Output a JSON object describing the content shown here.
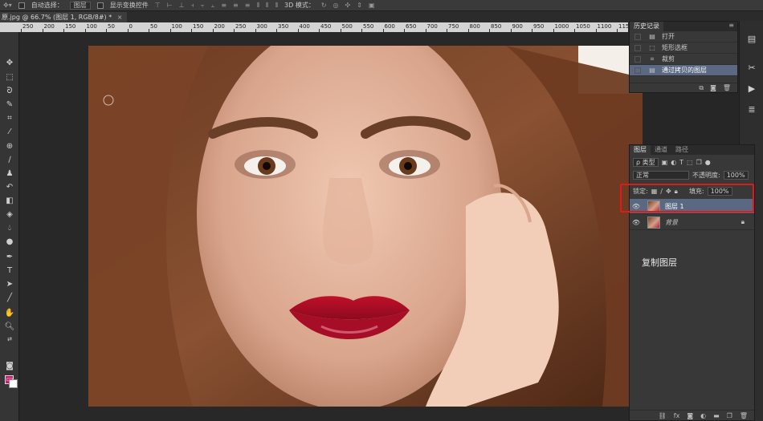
{
  "options_bar": {
    "move_icon": "move-tool-icon",
    "auto_select_label": "自动选择：",
    "auto_select_value": "图层",
    "show_transform_label": "显示变换控件",
    "mode_3d_label": "3D 模式："
  },
  "document": {
    "tab_title": "原.jpg @ 66.7% (图层 1, RGB/8#) *",
    "close_glyph": "×"
  },
  "ruler": {
    "ticks": [
      "250",
      "200",
      "150",
      "100",
      "50",
      "0",
      "50",
      "100",
      "150",
      "200",
      "250",
      "300",
      "350",
      "400",
      "450",
      "500",
      "550",
      "600",
      "650",
      "700",
      "750",
      "800",
      "850",
      "900",
      "950",
      "1000",
      "1050",
      "1100",
      "1150"
    ]
  },
  "history_panel": {
    "title": "历史记录",
    "snapshot_label": "原.jpg",
    "items": [
      {
        "icon": "document-icon",
        "label": "打开"
      },
      {
        "icon": "rect-marquee-icon",
        "label": "矩形选框"
      },
      {
        "icon": "crop-icon",
        "label": "裁剪"
      },
      {
        "icon": "document-icon",
        "label": "通过拷贝的图层",
        "active": true
      }
    ]
  },
  "layers_panel": {
    "tabs": [
      "图层",
      "通道",
      "路径"
    ],
    "active_tab": "图层",
    "filter_kind": "ρ 类型",
    "blend_mode": "正常",
    "opacity_label": "不透明度:",
    "opacity_value": "100%",
    "lock_label": "锁定:",
    "fill_label": "填充:",
    "fill_value": "100%",
    "layers": [
      {
        "name": "图层 1",
        "selected": true,
        "locked": false
      },
      {
        "name": "背景",
        "selected": false,
        "locked": true
      }
    ]
  },
  "annotation": {
    "text": "复制图层",
    "highlight_color": "#e01919"
  },
  "colors": {
    "foreground": "#d4136b",
    "background": "#ffffff",
    "selection": "#5a6882"
  }
}
